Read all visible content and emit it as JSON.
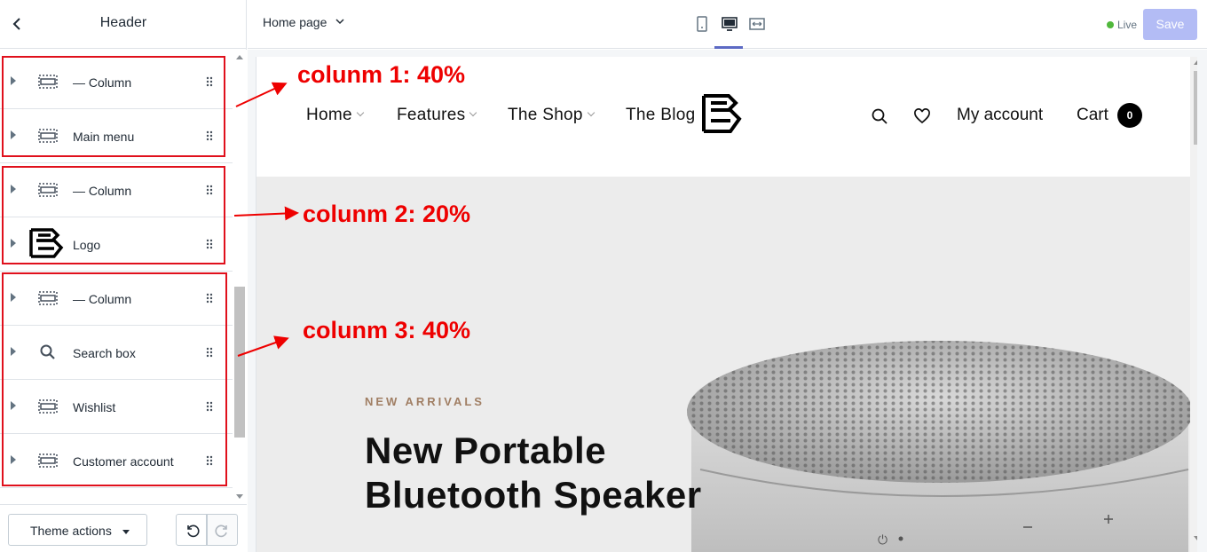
{
  "sidebar": {
    "title": "Header",
    "rows": [
      {
        "label": "— Column",
        "icon": "section-block-icon"
      },
      {
        "label": "Main menu",
        "icon": "section-block-icon"
      },
      {
        "label": "— Column",
        "icon": "section-block-icon"
      },
      {
        "label": "Logo",
        "icon": "logo-thumbnail-icon"
      },
      {
        "label": "— Column",
        "icon": "section-block-icon"
      },
      {
        "label": "Search box",
        "icon": "search-icon"
      },
      {
        "label": "Wishlist",
        "icon": "section-block-icon"
      },
      {
        "label": "Customer account",
        "icon": "section-block-icon"
      }
    ],
    "footer": {
      "theme_actions": "Theme actions"
    }
  },
  "topbar": {
    "page_select": "Home page",
    "devices": [
      "mobile-icon",
      "desktop-icon",
      "fullscreen-icon"
    ],
    "active_device": "desktop",
    "live_label": "Live",
    "save_label": "Save"
  },
  "store": {
    "nav": [
      "Home",
      "Features",
      "The Shop",
      "The Blog"
    ],
    "account_label": "My account",
    "cart_label": "Cart",
    "cart_count": "0",
    "hero_tag": "NEW ARRIVALS",
    "hero_title_line1": "New Portable",
    "hero_title_line2": "Bluetooth Speaker"
  },
  "annotations": {
    "col1": "colunm 1: 40%",
    "col2": "colunm 2: 20%",
    "col3": "colunm 3: 40%"
  },
  "colors": {
    "accent": "#5c6ac4",
    "save_disabled": "#b3bcf5",
    "live_dot": "#50b83c",
    "annotation_red": "#ee0000",
    "hero_tag": "#a07e63"
  }
}
